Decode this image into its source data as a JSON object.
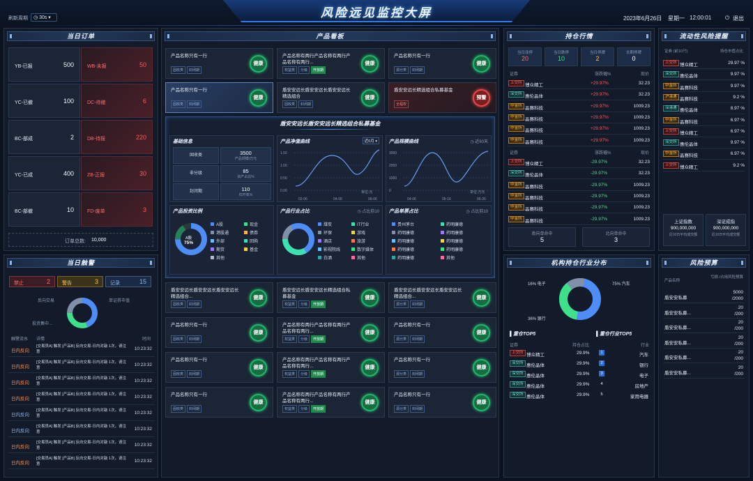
{
  "header": {
    "refresh_label": "刷新周期",
    "refresh_value": "30s",
    "title": "风险远见监控大屏",
    "date": "2023年6月26日",
    "weekday": "星期一",
    "time": "12:00:01",
    "logout": "退出"
  },
  "orders": {
    "title": "当日订单",
    "items": [
      {
        "label": "YB-已报",
        "value": "500",
        "alert": false
      },
      {
        "label": "WB-未报",
        "value": "50",
        "alert": true
      },
      {
        "label": "YC-已撤",
        "value": "100",
        "alert": false
      },
      {
        "label": "DC-待撤",
        "value": "6",
        "alert": true
      },
      {
        "label": "BC-部成",
        "value": "2",
        "alert": false
      },
      {
        "label": "DB-待报",
        "value": "220",
        "alert": true
      },
      {
        "label": "YC-已成",
        "value": "400",
        "alert": false
      },
      {
        "label": "ZB-正报",
        "value": "30",
        "alert": true
      },
      {
        "label": "BC-部撤",
        "value": "10",
        "alert": false
      },
      {
        "label": "FD-废单",
        "value": "3",
        "alert": true
      }
    ],
    "total_label": "订单总数:",
    "total": "10,000"
  },
  "triggers": {
    "title": "当日触警",
    "stats": [
      {
        "label": "禁止",
        "value": "2"
      },
      {
        "label": "警告",
        "value": "3"
      },
      {
        "label": "记录",
        "value": "15"
      }
    ],
    "donut_labels": [
      "反向交易",
      "单证券市值",
      "投资集中..."
    ],
    "cols": [
      "触警流水",
      "详情",
      "时间"
    ],
    "rows": [
      {
        "type": "日内反向",
        "detail": "[交易员A] 触发 [产品B] 反向交易-日内对敲 1次，请注意",
        "time": "10:23:32"
      },
      {
        "type": "日内反向",
        "detail": "[交易员A] 触发 [产品B] 反向交易-日内对敲 1次，请注意",
        "time": "10:23:32"
      },
      {
        "type": "日内反向",
        "detail": "[交易员A] 触发 [产品B] 反向交易-日内对敲 1次，请注意",
        "time": "10:23:32"
      },
      {
        "type": "日内反向",
        "detail": "[交易员A] 触发 [产品B] 反向交易-日内对敲 1次，请注意",
        "time": "10:23:32"
      },
      {
        "type": "日内反向",
        "detail": "[交易员A] 触发 [产品B] 反向交易-日内对敲 1次，请注意",
        "time": "10:23:32"
      },
      {
        "type": "日内反向",
        "detail": "[交易员A] 触发 [产品B] 反向交易-日内对敲 1次，请注意",
        "time": "10:23:32"
      },
      {
        "type": "日内反向",
        "detail": "[交易员A] 触发 [产品B] 反向交易-日内对敲 1次，请注意",
        "time": "10:23:32"
      },
      {
        "type": "日内反向",
        "detail": "[交易员A] 触发 [产品B] 反向交易-日内对敲 1次，请注意",
        "time": "10:23:32"
      }
    ]
  },
  "products": {
    "title": "产品看板",
    "badge": "健康",
    "badge_warn": "预警",
    "tags": {
      "a": "固收类",
      "b": "封闭期",
      "c": "权益类",
      "d": "分级",
      "e": "开放期",
      "f": "源分类",
      "g": "全程权"
    },
    "row1": [
      {
        "name": "产品名称只有一行",
        "long": false
      },
      {
        "name": "产品名称有两行产品名称有两行产品名称有两行...",
        "long": true
      },
      {
        "name": "产品名称只有一行",
        "long": false
      }
    ],
    "row2": [
      {
        "name": "产品名称只有一行"
      },
      {
        "name": "盾安安远长盾安安远长盾安安远长精选组合"
      },
      {
        "name": "盾安安远长精选组合私募基金"
      }
    ],
    "bottom": [
      {
        "name": "盾安安远长盾安安远长盾安安远长精选组合..."
      },
      {
        "name": "盾安安远长盾安安远长精选组合私募基金"
      },
      {
        "name": "盾安安远长盾安安远长盾安安远长精选组合..."
      },
      {
        "name": "产品名称只有一行"
      },
      {
        "name": "产品名称有两行产品名称有两行产品名称有两行..."
      },
      {
        "name": "产品名称只有一行"
      },
      {
        "name": "产品名称只有一行"
      },
      {
        "name": "产品名称有两行产品名称有两行产品名称有两行..."
      },
      {
        "name": "产品名称只有一行"
      },
      {
        "name": "产品名称只有一行"
      },
      {
        "name": "产品名称有两行产品名称有两行产品名称有两行..."
      },
      {
        "name": "产品名称只有一行"
      }
    ]
  },
  "detail": {
    "title": "盾安安远长盾安安远长精选组合私募基金",
    "basic": {
      "title": "基础信息",
      "rows": [
        {
          "k": "固收类",
          "v": "3500",
          "s": "产品规模/万元"
        },
        {
          "k": "非分级",
          "v": "85",
          "s": "资产占比%"
        },
        {
          "k": "封闭期",
          "v": "110",
          "s": "杠杆率%"
        }
      ]
    },
    "nav": {
      "title": "产品净值曲线",
      "select": "近6月",
      "unit": "单位:元",
      "yticks": [
        "1.50",
        "1.00",
        "0.50",
        "0.00"
      ],
      "xticks": [
        "02-06",
        "04-06",
        "06-06"
      ]
    },
    "scale": {
      "title": "产品规模曲线",
      "range": "近60天",
      "unit": "单位:万元",
      "yticks": [
        "3000",
        "2000",
        "1000",
        "0"
      ],
      "xticks": [
        "04-06",
        "05-16",
        "06-26"
      ]
    },
    "invest": {
      "title": "产品投资比例",
      "center_label": "A股",
      "center_value": "75%",
      "legend": [
        "A股",
        "现金",
        "港股通",
        "债券",
        "外部",
        "回购",
        "期货",
        "基金",
        "其他"
      ]
    },
    "industry": {
      "title": "产品行业占比",
      "note": "占比前10",
      "legend": [
        "煤炭",
        "IT行业",
        "环保",
        "游戏",
        "酒店",
        "旅游",
        "影视院线",
        "数字媒体",
        "白酒",
        "其他"
      ]
    },
    "stock": {
      "title": "产品单票占比",
      "note": "占比前10",
      "legend": [
        "贵州茅台",
        "药明康德",
        "药明康德",
        "药明康德",
        "药明康德",
        "药明康德",
        "药明康德",
        "药明康德",
        "药明康德",
        "其他"
      ]
    }
  },
  "market": {
    "title": "持仓行情",
    "stats": [
      {
        "label": "当日涨停",
        "value": "20"
      },
      {
        "label": "当日跌停",
        "value": "10"
      },
      {
        "label": "当日停牌",
        "value": "2"
      },
      {
        "label": "长期停牌",
        "value": "0"
      }
    ],
    "cols": [
      "证券",
      "涨跌幅%",
      "现价"
    ],
    "up": [
      {
        "ex": "上交所",
        "name": "博众精工",
        "chg": "+29.97%",
        "price": "32.23"
      },
      {
        "ex": "深交所",
        "name": "惠伦晶体",
        "chg": "+29.97%",
        "price": "32.23"
      },
      {
        "ex": "中金所",
        "name": "晶赛科技",
        "chg": "+29.97%",
        "price": "1009.23"
      },
      {
        "ex": "中金所",
        "name": "晶赛科技",
        "chg": "+29.97%",
        "price": "1009.23"
      },
      {
        "ex": "中金所",
        "name": "晶赛科技",
        "chg": "+29.97%",
        "price": "1009.23"
      },
      {
        "ex": "中金所",
        "name": "晶赛科技",
        "chg": "+29.97%",
        "price": "1009.23"
      }
    ],
    "down": [
      {
        "ex": "上交所",
        "name": "博众精工",
        "chg": "-29.97%",
        "price": "32.23"
      },
      {
        "ex": "深交所",
        "name": "惠伦晶体",
        "chg": "-29.97%",
        "price": "32.23"
      },
      {
        "ex": "中金所",
        "name": "晶赛科技",
        "chg": "-29.97%",
        "price": "1009.23"
      },
      {
        "ex": "中金所",
        "name": "晶赛科技",
        "chg": "-29.97%",
        "price": "1009.23"
      },
      {
        "ex": "中金所",
        "name": "晶赛科技",
        "chg": "-29.97%",
        "price": "1009.23"
      },
      {
        "ex": "中金所",
        "name": "晶赛科技",
        "chg": "-29.97%",
        "price": "1009.23"
      }
    ],
    "south": {
      "label": "南向单命中",
      "value": "5"
    },
    "north": {
      "label": "北向单命中",
      "value": "3"
    }
  },
  "liquidity": {
    "title": "流动性风险提醒",
    "cols": [
      "证券 (前10只)",
      "持仓市值占比"
    ],
    "rows": [
      {
        "ex": "上交所",
        "name": "博众精工",
        "v": "29.97 %"
      },
      {
        "ex": "深交所",
        "name": "惠伦晶体",
        "v": "9.97 %"
      },
      {
        "ex": "中金所",
        "name": "晶赛科技",
        "v": "9.97 %"
      },
      {
        "ex": "沪港通",
        "name": "晶赛科技",
        "v": "9.2 %"
      },
      {
        "ex": "深港通",
        "name": "惠伦晶体",
        "v": "8.97 %"
      },
      {
        "ex": "中金所",
        "name": "晶赛科技",
        "v": "6.97 %"
      },
      {
        "ex": "上交所",
        "name": "博众精工",
        "v": "6.97 %"
      },
      {
        "ex": "深交所",
        "name": "惠伦晶体",
        "v": "9.97 %"
      },
      {
        "ex": "中金所",
        "name": "晶赛科技",
        "v": "6.97 %"
      },
      {
        "ex": "上交所",
        "name": "博众精工",
        "v": "9.2 %"
      }
    ],
    "idx": [
      {
        "label": "上证指数",
        "value": "900,000,000",
        "sub": "近10日平均成交额"
      },
      {
        "label": "深证成指",
        "value": "900,000,000",
        "sub": "近10日平均成交额"
      }
    ]
  },
  "inst": {
    "title": "机构持仓行业分布",
    "labels": [
      {
        "t": "16% 电子"
      },
      {
        "t": "75% 汽车"
      },
      {
        "t": "36% 银行"
      }
    ],
    "heavy": {
      "title": "重仓TOP5",
      "cols": [
        "证券",
        "持仓占比"
      ],
      "rows": [
        {
          "ex": "上交所",
          "name": "博众精工",
          "v": "29.9%"
        },
        {
          "ex": "深交所",
          "name": "惠伦晶体",
          "v": "29.9%"
        },
        {
          "ex": "深交所",
          "name": "惠伦晶体",
          "v": "29.9%"
        },
        {
          "ex": "深交所",
          "name": "惠伦晶体",
          "v": "29.9%"
        },
        {
          "ex": "深交所",
          "name": "惠伦晶体",
          "v": "29.9%"
        }
      ]
    },
    "ind": {
      "title": "重仓行业TOP5",
      "col": "行业",
      "rows": [
        {
          "n": "1",
          "v": "汽车"
        },
        {
          "n": "2",
          "v": "银行"
        },
        {
          "n": "3",
          "v": "电子"
        },
        {
          "n": "4",
          "v": "房地产"
        },
        {
          "n": "5",
          "v": "家用电器"
        }
      ]
    }
  },
  "budget": {
    "title": "风险预算",
    "cols": [
      "产品名称",
      "亏损 /占用风险预算"
    ],
    "rows": [
      {
        "name": "盾安安私募",
        "v1": "5000",
        "v2": "/2000"
      },
      {
        "name": "盾安安私募...",
        "v1": "20",
        "v2": "/200"
      },
      {
        "name": "盾安安私募...",
        "v1": "20",
        "v2": "/200"
      },
      {
        "name": "盾安安私募...",
        "v1": "20",
        "v2": "/200"
      },
      {
        "name": "盾安安私募...",
        "v1": "20",
        "v2": "/200"
      },
      {
        "name": "盾安安私募...",
        "v1": "20",
        "v2": "/200"
      }
    ]
  },
  "colors": {
    "accent": "#3a7ff0",
    "green": "#24c974",
    "red": "#ff5a5a",
    "bg": "#0b1220"
  }
}
